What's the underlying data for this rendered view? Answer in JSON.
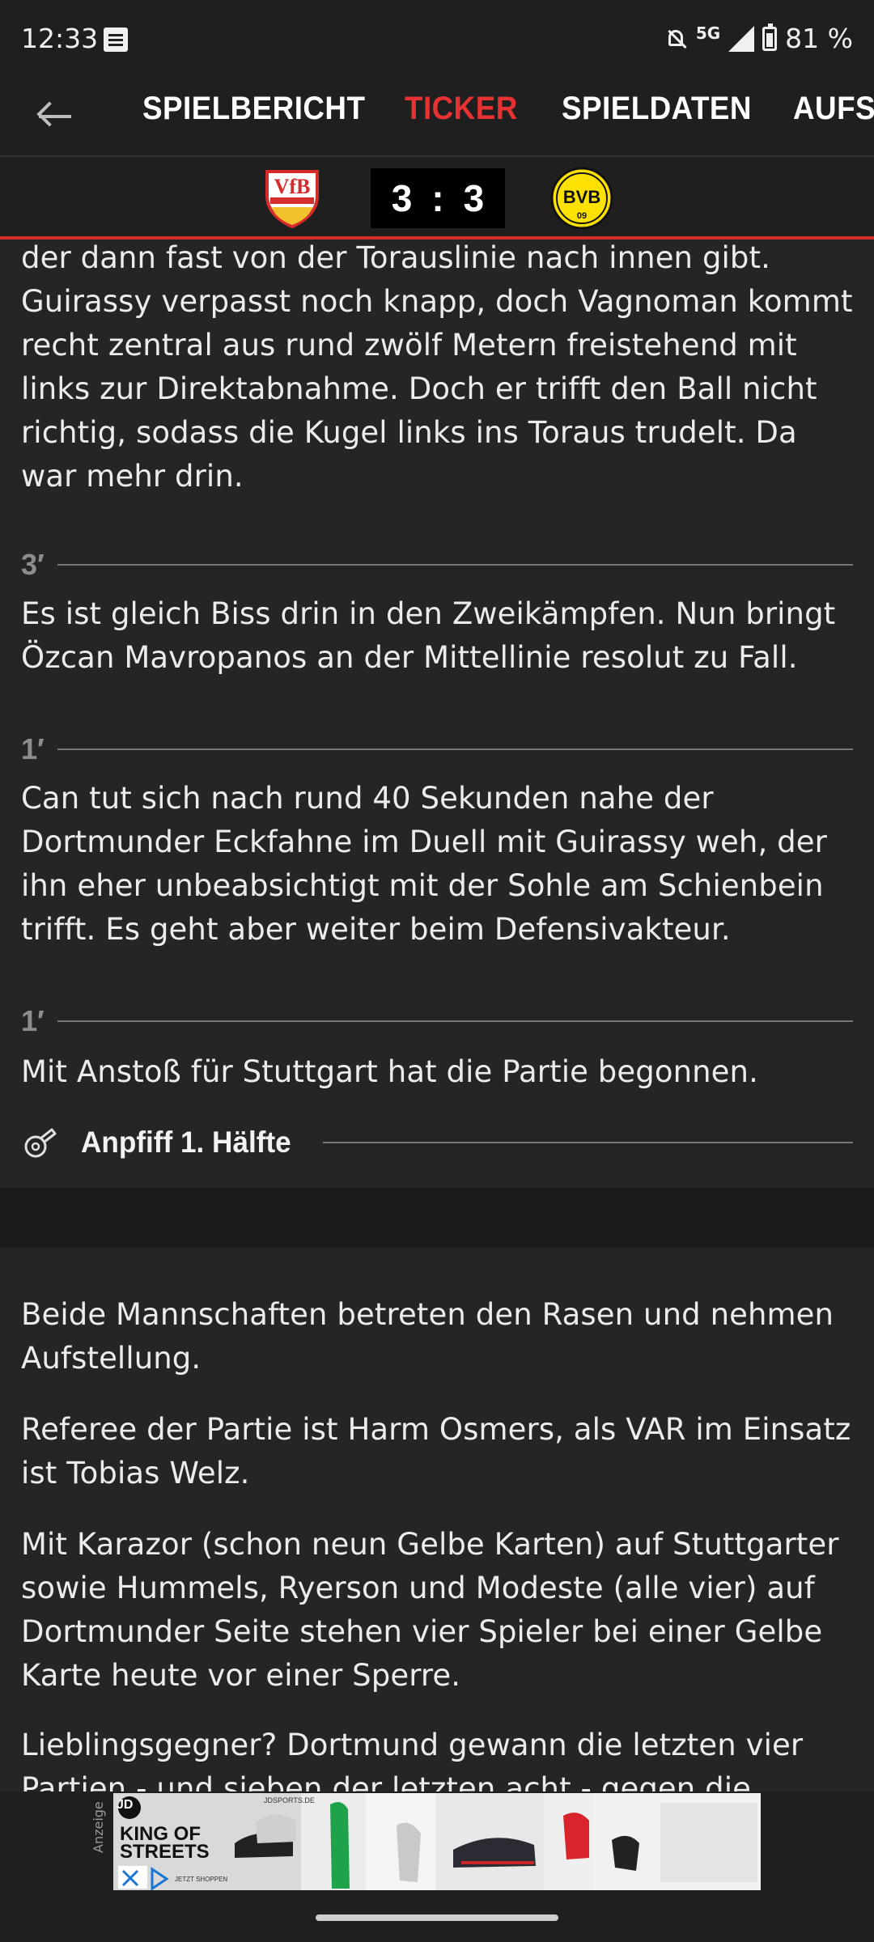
{
  "status_bar": {
    "time": "12:33",
    "network": "5G",
    "battery": "81 %",
    "icons": [
      "document-icon",
      "bell-off-icon",
      "signal-icon",
      "battery-icon"
    ]
  },
  "tabs": [
    {
      "label": "SPIELBERICHT",
      "active": false
    },
    {
      "label": "TICKER",
      "active": true
    },
    {
      "label": "SPIELDATEN",
      "active": false
    },
    {
      "label": "AUFST",
      "active": false
    }
  ],
  "scoreboard": {
    "home_goals": "3",
    "separator": ":",
    "away_goals": "3",
    "home_crest_text": "VfB",
    "away_crest_text": "BVB",
    "away_crest_year": "09"
  },
  "ticker": {
    "top_paragraph": "der dann fast von der Torauslinie nach innen gibt. Guirassy verpasst noch knapp, doch Vagnoman kommt recht zentral aus rund zwölf Metern freistehend mit links zur Direktabnahme. Doch er trifft den Ball nicht richtig, sodass die Kugel links ins Toraus trudelt. Da war mehr drin.",
    "entries": [
      {
        "minute": "3′",
        "text": "Es ist gleich Biss drin in den Zweikämpfen. Nun bringt Özcan Mavropanos an der Mittellinie resolut zu Fall."
      },
      {
        "minute": "1′",
        "text": "Can tut sich nach rund 40 Sekunden nahe der Dortmunder Eckfahne im Duell mit Guirassy weh, der ihn eher unbeabsichtigt mit der Sohle am Schienbein trifft. Es geht aber weiter beim Defensivakteur."
      },
      {
        "minute": "1′",
        "text": "Mit Anstoß für Stuttgart hat die Partie begonnen."
      }
    ],
    "kickoff_label": "Anpfiff 1. Hälfte",
    "pre_match": [
      "Beide Mannschaften betreten den Rasen und nehmen Aufstellung.",
      "Referee der Partie ist Harm Osmers, als VAR im Einsatz ist Tobias Welz.",
      "Mit Karazor (schon neun Gelbe Karten) auf Stuttgarter sowie Hummels, Ryerson und Modeste (alle vier) auf Dortmunder Seite stehen vier Spieler bei einer Gelbe Karte heute vor einer Sperre.",
      "Lieblingsgegner? Dortmund gewann die letzten vier Partien - und sieben der letzten acht - gegen die"
    ]
  },
  "ad": {
    "label": "Anzeige",
    "brand": "JD",
    "headline_1": "KING OF",
    "headline_2": "STREETS",
    "site": "JDSPORTS.DE",
    "cta": "JETZT SHOPPEN"
  },
  "colors": {
    "background": "#252526",
    "bar": "#1f1f1f",
    "accent": "#e63232",
    "bvb_yellow": "#fde100"
  }
}
